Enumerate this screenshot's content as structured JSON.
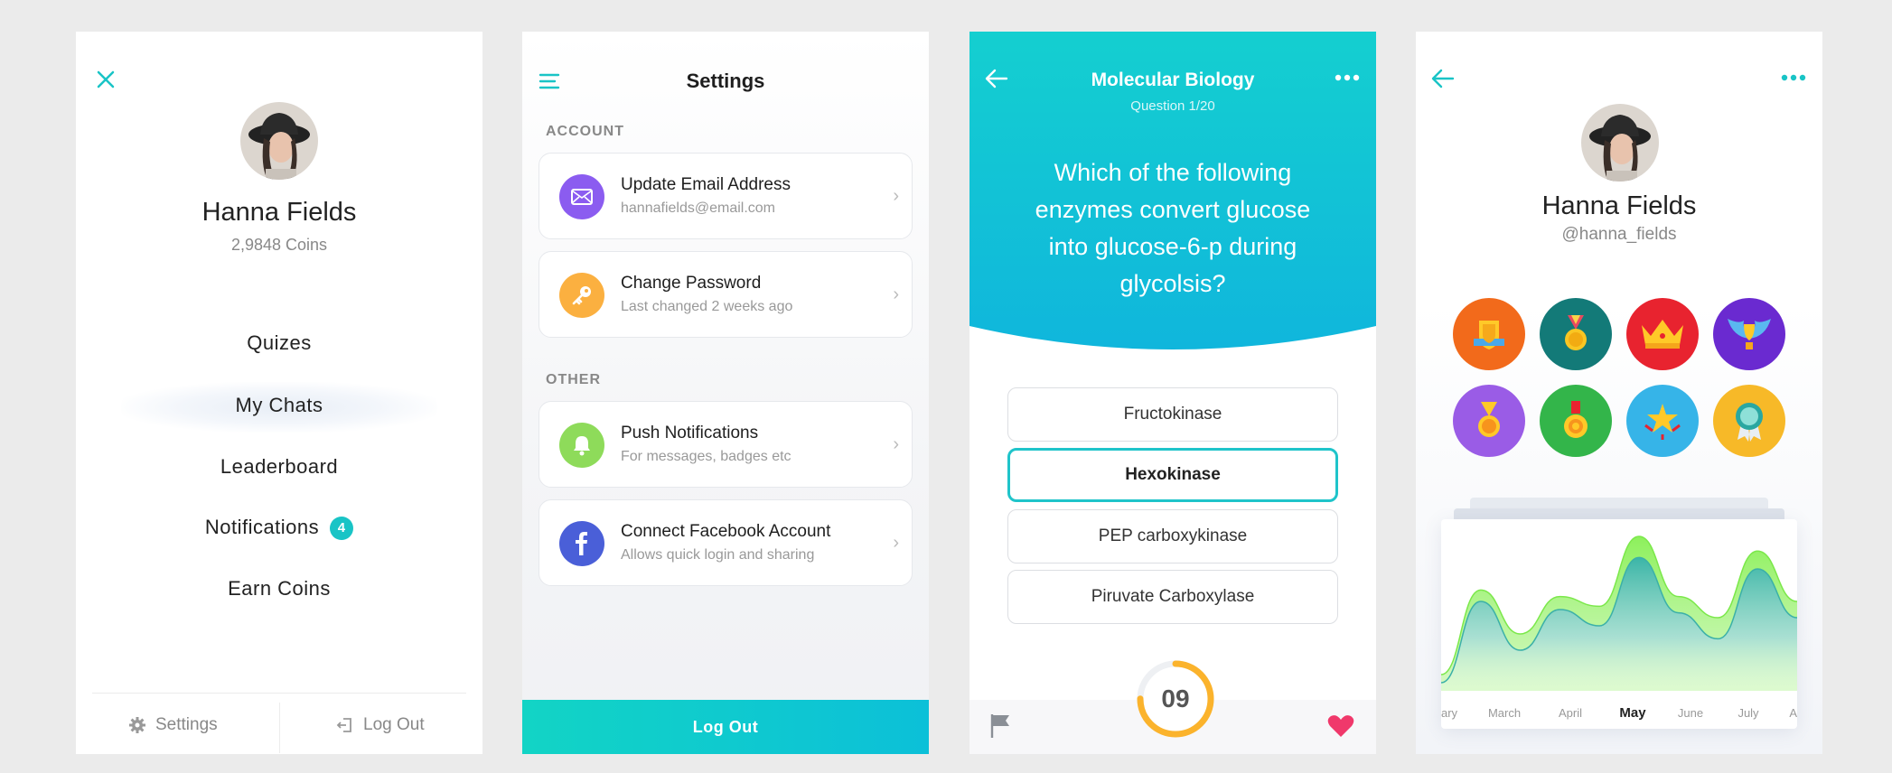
{
  "screen1": {
    "user_name": "Hanna Fields",
    "coins": "2,9848 Coins",
    "menu": [
      {
        "label": "Quizes"
      },
      {
        "label": "My Chats",
        "active": true
      },
      {
        "label": "Leaderboard"
      },
      {
        "label": "Notifications",
        "badge": "4"
      },
      {
        "label": "Earn Coins"
      }
    ],
    "footer": {
      "settings": "Settings",
      "logout": "Log Out"
    },
    "accent": "#19c4c6"
  },
  "screen2": {
    "title": "Settings",
    "section_account": "ACCOUNT",
    "section_other": "OTHER",
    "items": [
      {
        "title": "Update Email Address",
        "subtitle": "hannafields@email.com",
        "icon": "envelope-icon",
        "color": "#8b5cf0"
      },
      {
        "title": "Change Password",
        "subtitle": "Last changed 2 weeks ago",
        "icon": "key-icon",
        "color": "#fbb040"
      },
      {
        "title": "Push Notifications",
        "subtitle": "For messages, badges etc",
        "icon": "bell-icon",
        "color": "#8edb5a"
      },
      {
        "title": "Connect Facebook Account",
        "subtitle": "Allows quick login and sharing",
        "icon": "facebook-icon",
        "color": "#4a5fd8"
      }
    ],
    "logout": "Log Out"
  },
  "screen3": {
    "title": "Molecular Biology",
    "subtitle": "Question 1/20",
    "question": "Which of the following enzymes convert glucose into glucose-6-p during glycolsis?",
    "answers": [
      {
        "label": "Fructokinase"
      },
      {
        "label": "Hexokinase",
        "selected": true
      },
      {
        "label": "PEP carboxykinase"
      },
      {
        "label": "Piruvate Carboxylase"
      }
    ],
    "timer": "09",
    "timer_progress": 0.75
  },
  "screen4": {
    "user_name": "Hanna Fields",
    "handle": "@hanna_fields",
    "medals": [
      {
        "icon": "shield-medal-icon",
        "color": "#f26a1b"
      },
      {
        "icon": "gold-medal-icon",
        "color": "#137a78"
      },
      {
        "icon": "crown-icon",
        "color": "#e8232f"
      },
      {
        "icon": "wings-trophy-icon",
        "color": "#6a2ad0"
      },
      {
        "icon": "ribbon-medal-icon",
        "color": "#9a5ce6"
      },
      {
        "icon": "star-medal-icon",
        "color": "#33b54a"
      },
      {
        "icon": "star-burst-icon",
        "color": "#36b4e8"
      },
      {
        "icon": "rosette-icon",
        "color": "#f7b928"
      }
    ],
    "chart_data": {
      "type": "area",
      "x": [
        "ary",
        "March",
        "April",
        "May",
        "June",
        "July",
        "A"
      ],
      "highlight": "May",
      "series": [
        {
          "values": [
            0.1,
            0.62,
            0.35,
            0.58,
            0.52,
            0.95,
            0.58,
            0.45,
            0.86,
            0.55
          ]
        },
        {
          "values": [
            0.05,
            0.55,
            0.25,
            0.5,
            0.4,
            0.82,
            0.48,
            0.32,
            0.75,
            0.45
          ]
        }
      ]
    }
  }
}
